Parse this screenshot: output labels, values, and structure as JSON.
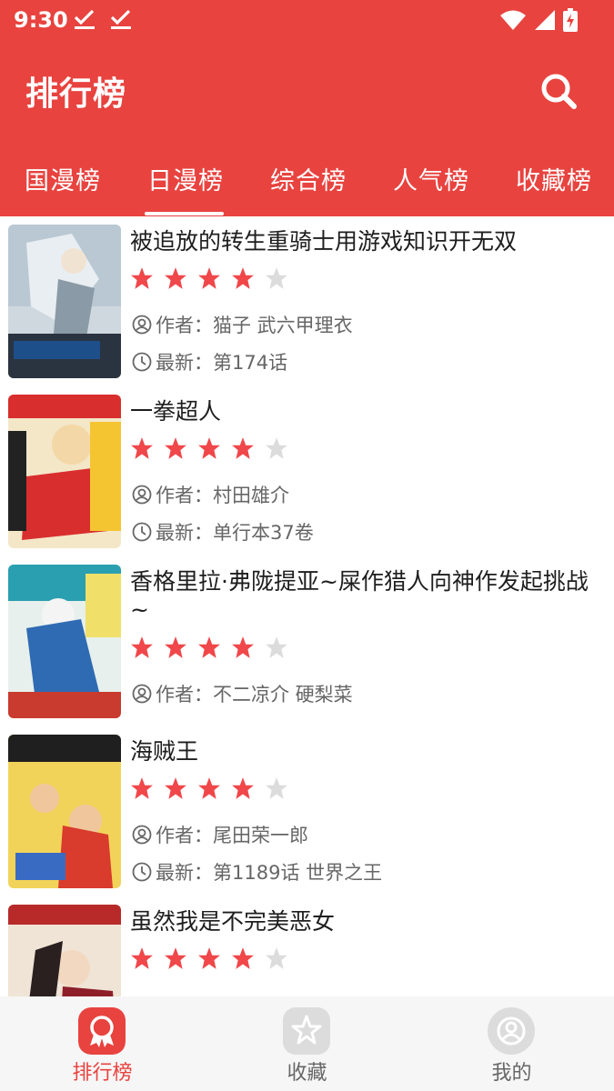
{
  "status_bar": {
    "time": "9:30"
  },
  "header": {
    "title": "排行榜"
  },
  "tabs": [
    {
      "label": "国漫榜"
    },
    {
      "label": "日漫榜"
    },
    {
      "label": "综合榜"
    },
    {
      "label": "人气榜"
    },
    {
      "label": "收藏榜"
    }
  ],
  "active_tab": "日漫榜",
  "colors": {
    "brand": "#e8433f",
    "star_on": "#f0474a",
    "star_off": "#dcdcdc"
  },
  "comics": [
    {
      "title": "被追放的转生重骑士用游戏知识开无双",
      "rating": 4,
      "max_rating": 5,
      "author_label": "作者：",
      "author": "猫子 武六甲理衣",
      "latest_label": "最新：",
      "latest": "第174话"
    },
    {
      "title": "一拳超人",
      "rating": 4,
      "max_rating": 5,
      "author_label": "作者：",
      "author": "村田雄介",
      "latest_label": "最新：",
      "latest": "单行本37卷"
    },
    {
      "title": "香格里拉·弗陇提亚~屎作猎人向神作发起挑战~",
      "rating": 4,
      "max_rating": 5,
      "author_label": "作者：",
      "author": "不二凉介 硬梨菜",
      "latest_label": "",
      "latest": ""
    },
    {
      "title": "海贼王",
      "rating": 4,
      "max_rating": 5,
      "author_label": "作者：",
      "author": "尾田荣一郎",
      "latest_label": "最新：",
      "latest": "第1189话 世界之王"
    },
    {
      "title": "虽然我是不完美恶女",
      "rating": 4,
      "max_rating": 5,
      "author_label": "",
      "author": "",
      "latest_label": "",
      "latest": ""
    }
  ],
  "bottom_nav": [
    {
      "label": "排行榜",
      "icon": "ranking-icon",
      "active": true
    },
    {
      "label": "收藏",
      "icon": "star-icon",
      "active": false
    },
    {
      "label": "我的",
      "icon": "profile-icon",
      "active": false
    }
  ]
}
